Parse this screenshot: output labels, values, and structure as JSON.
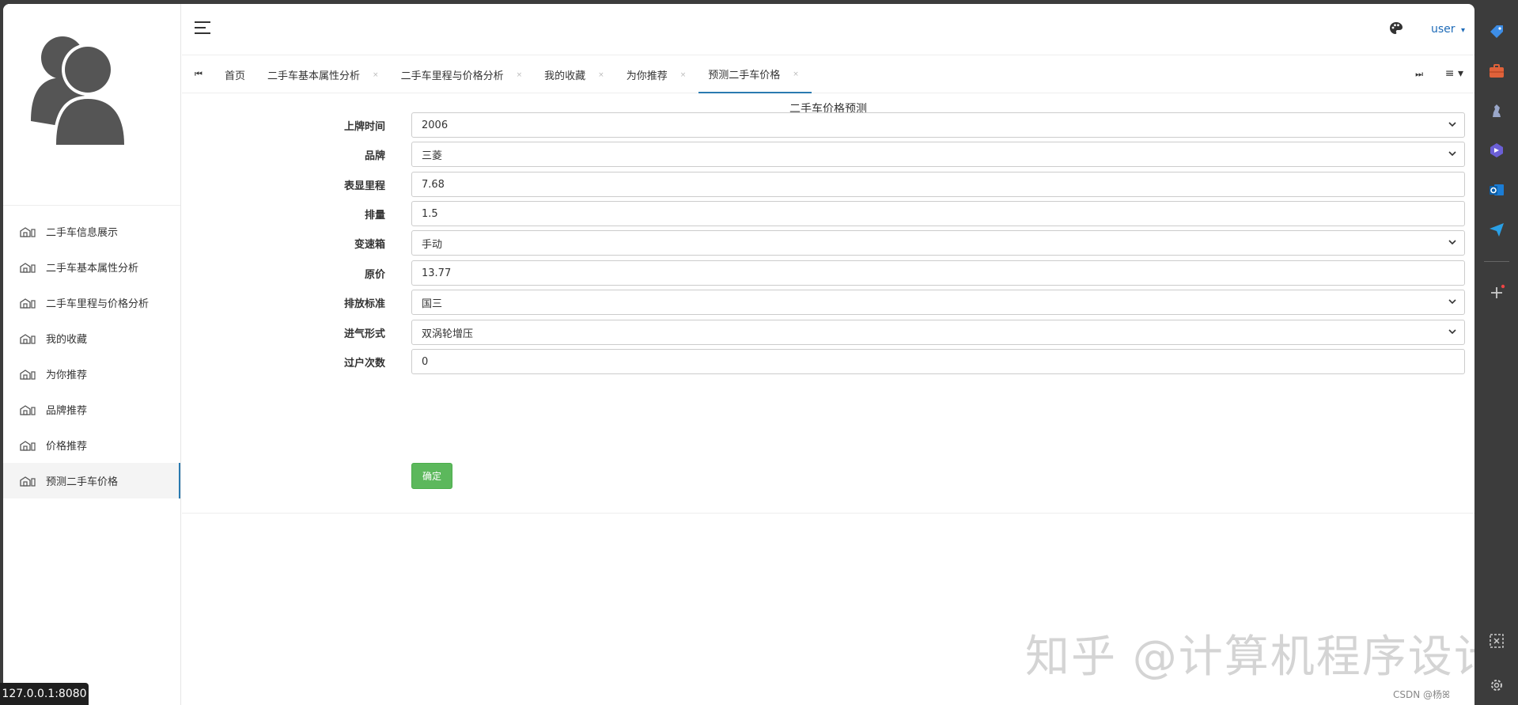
{
  "sidebar": {
    "items": [
      {
        "label": "二手车信息展示"
      },
      {
        "label": "二手车基本属性分析"
      },
      {
        "label": "二手车里程与价格分析"
      },
      {
        "label": "我的收藏"
      },
      {
        "label": "为你推荐"
      },
      {
        "label": "品牌推荐"
      },
      {
        "label": "价格推荐"
      },
      {
        "label": "预测二手车价格"
      }
    ],
    "active_index": 7
  },
  "header": {
    "user_label": "user",
    "user_caret": "▾"
  },
  "tabs": {
    "first_glyph": "⏮",
    "last_glyph": "⏭",
    "list_menu_glyph": "≡ ▾",
    "items": [
      {
        "label": "首页",
        "closable": false
      },
      {
        "label": "二手车基本属性分析",
        "closable": true
      },
      {
        "label": "二手车里程与价格分析",
        "closable": true
      },
      {
        "label": "我的收藏",
        "closable": true
      },
      {
        "label": "为你推荐",
        "closable": true
      },
      {
        "label": "预测二手车价格",
        "closable": true
      }
    ],
    "close_glyph": "×"
  },
  "form": {
    "title": "二手车价格预测",
    "fields": [
      {
        "label": "上牌时间",
        "value": "2006",
        "type": "select"
      },
      {
        "label": "品牌",
        "value": "三菱",
        "type": "select"
      },
      {
        "label": "表显里程",
        "value": "7.68",
        "type": "input"
      },
      {
        "label": "排量",
        "value": "1.5",
        "type": "input"
      },
      {
        "label": "变速箱",
        "value": "手动",
        "type": "select"
      },
      {
        "label": "原价",
        "value": "13.77",
        "type": "input"
      },
      {
        "label": "排放标准",
        "value": "国三",
        "type": "select"
      },
      {
        "label": "进气形式",
        "value": "双涡轮增压",
        "type": "select"
      },
      {
        "label": "过户次数",
        "value": "0",
        "type": "input"
      }
    ],
    "submit_label": "确定"
  },
  "watermark": "知乎 @计算机程序设计",
  "status_url": "127.0.0.1:8080",
  "credit": "CSDN @杨ꕤ",
  "colors": {
    "accent": "#2a7ab0",
    "confirm": "#5cb85c",
    "user_link": "#1e6bb8"
  },
  "rail_icons": [
    "tag-icon",
    "briefcase-icon",
    "chess-icon",
    "copilot-icon",
    "outlook-icon",
    "send-icon",
    "add-icon",
    "screenshot-icon",
    "settings-icon"
  ]
}
